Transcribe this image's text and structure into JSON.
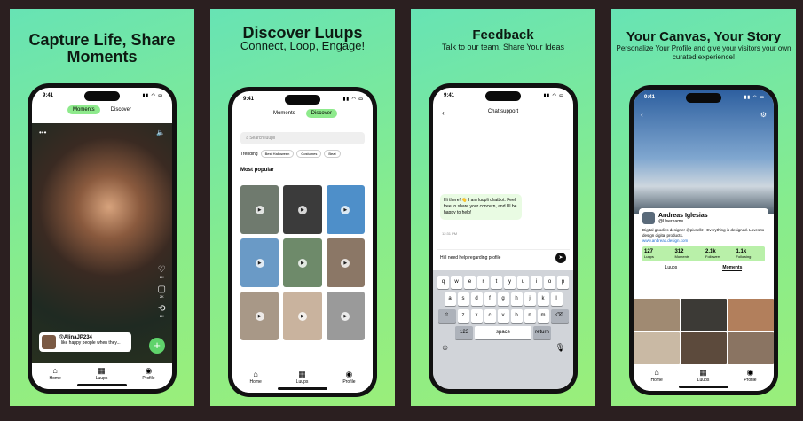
{
  "panels": [
    {
      "headline": "Capture Life, Share Moments",
      "phone": {
        "time": "9:41",
        "tabs": [
          {
            "label": "Moments",
            "active": true
          },
          {
            "label": "Discover",
            "active": false
          }
        ],
        "side_actions": [
          {
            "icon": "heart-icon",
            "count": "2K"
          },
          {
            "icon": "comment-icon",
            "count": "2K"
          },
          {
            "icon": "loop-icon",
            "count": "2K"
          }
        ],
        "caption": {
          "user": "@AlinaJP234",
          "text": "I like happy people when they..."
        },
        "nav": [
          "Home",
          "Luups",
          "Profile"
        ]
      }
    },
    {
      "headline": "Discover Luups",
      "subheadline": "Connect, Loop, Engage!",
      "phone": {
        "time": "9:41",
        "tabs": [
          {
            "label": "Moments",
            "active": false
          },
          {
            "label": "Discover",
            "active": true
          }
        ],
        "search_placeholder": "Search luupli",
        "trending_label": "Trending",
        "trending_chips": [
          "Best Halloween",
          "Costumes",
          "Beat"
        ],
        "section_title": "Most popular",
        "nav": [
          "Home",
          "Luups",
          "Profile"
        ]
      }
    },
    {
      "headline": "Feedback",
      "subheadline": "Talk to our team, Share Your Ideas",
      "phone": {
        "time": "9:41",
        "chat_title": "Chat support",
        "bot_message": "Hi there! 👋 I am luupli chatbot. Feel free to share your concern, and I'll be happy to help!",
        "message_time": "12:31 PM",
        "input_text": "Hi I need help regarding profile",
        "keyboard_rows": [
          [
            "q",
            "w",
            "e",
            "r",
            "t",
            "y",
            "u",
            "i",
            "o",
            "p"
          ],
          [
            "a",
            "s",
            "d",
            "f",
            "g",
            "h",
            "j",
            "k",
            "l"
          ],
          [
            "z",
            "x",
            "c",
            "v",
            "b",
            "n",
            "m"
          ]
        ],
        "key_123": "123",
        "key_space": "space",
        "key_return": "return"
      }
    },
    {
      "headline": "Your Canvas, Your Story",
      "subheadline": "Personalize Your Profile and give your visitors your own curated experience!",
      "phone": {
        "time": "9:41",
        "name": "Andreas Iglesias",
        "username": "@Username",
        "bio": "Digital goodies designer @pixsellz . Everything is designed. Loves to design digital products.",
        "website": "www.andreas.design.com",
        "stats": [
          {
            "value": "127",
            "label": "Luups"
          },
          {
            "value": "312",
            "label": "Moments"
          },
          {
            "value": "2.1k",
            "label": "Followers"
          },
          {
            "value": "1.1k",
            "label": "Following"
          }
        ],
        "profile_tabs": [
          {
            "label": "Luups",
            "active": false
          },
          {
            "label": "Moments",
            "active": true
          }
        ],
        "nav": [
          "Home",
          "Luups",
          "Profile"
        ]
      }
    }
  ],
  "colors": {
    "panel_gradient_start": "#67e3b4",
    "panel_gradient_end": "#9aee7a",
    "accent_green": "#8eea8c",
    "background": "#2b1f20"
  }
}
